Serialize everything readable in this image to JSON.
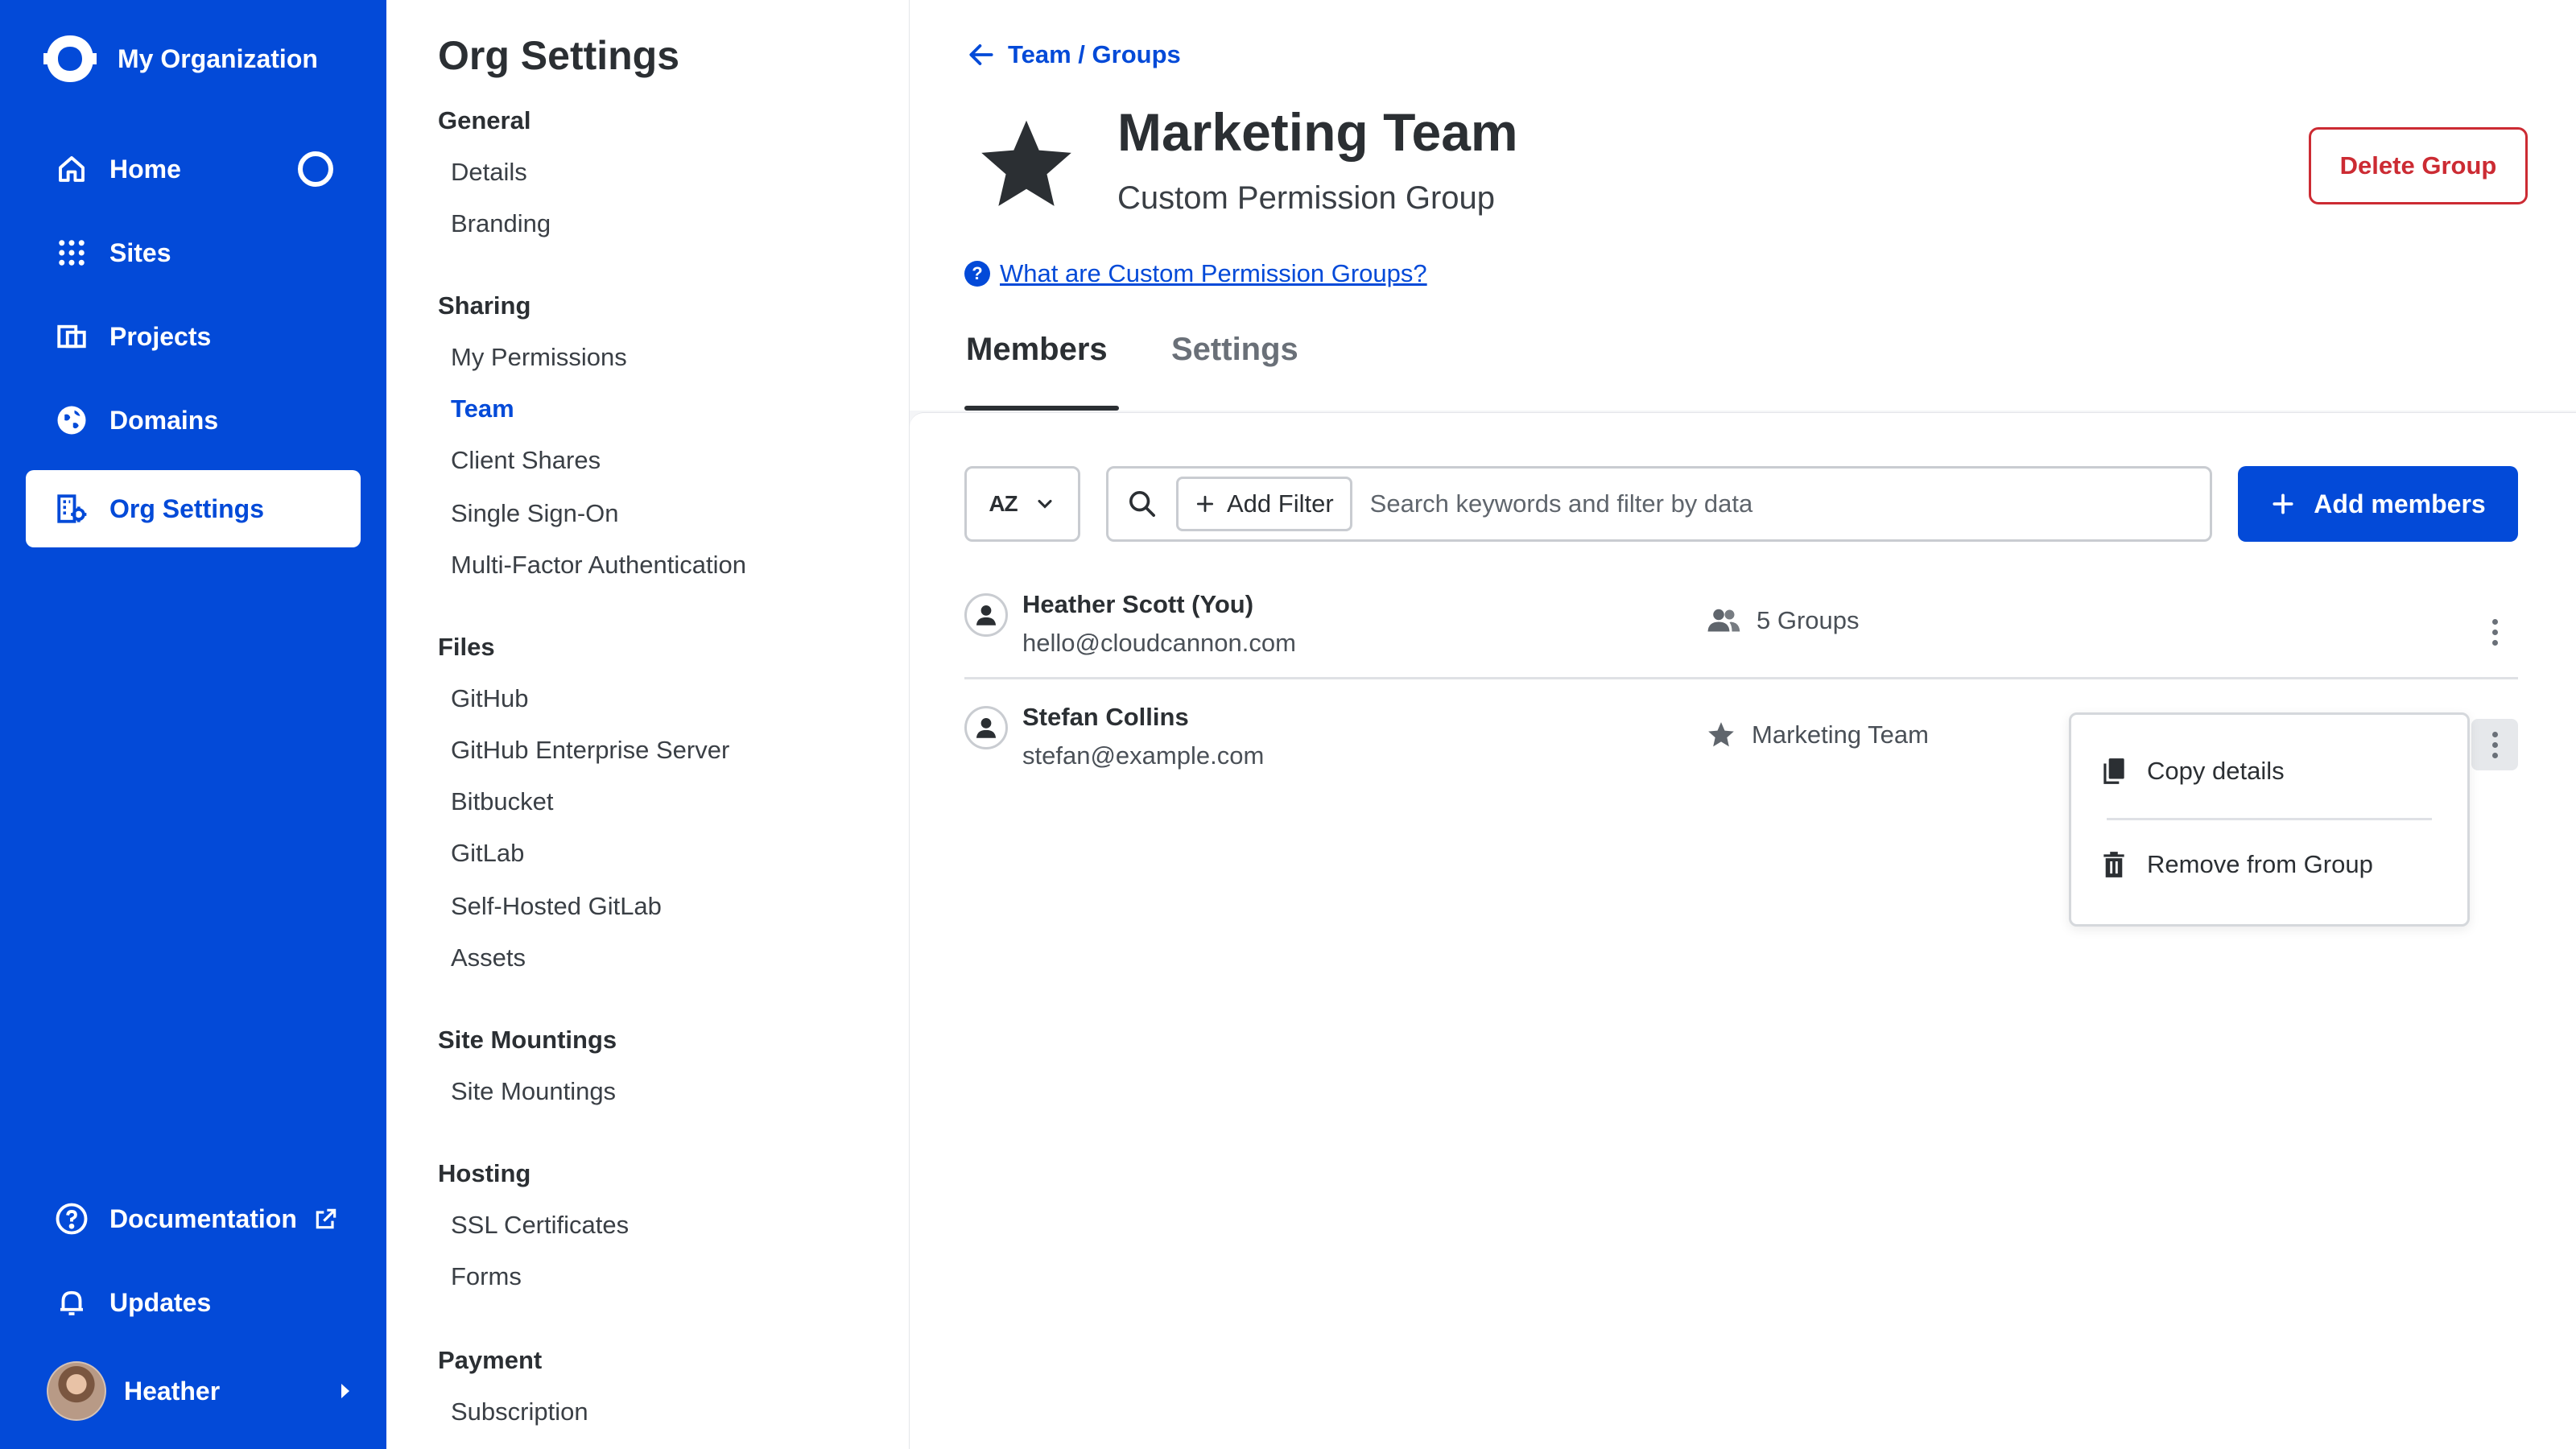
{
  "org": {
    "name": "My Organization"
  },
  "nav": {
    "items": [
      {
        "label": "Home",
        "icon": "home-icon"
      },
      {
        "label": "Sites",
        "icon": "grid-icon"
      },
      {
        "label": "Projects",
        "icon": "projects-icon"
      },
      {
        "label": "Domains",
        "icon": "globe-icon"
      },
      {
        "label": "Org Settings",
        "icon": "org-settings-icon",
        "active": true
      }
    ],
    "bottom": [
      {
        "label": "Documentation",
        "icon": "help-circle-icon"
      },
      {
        "label": "Updates",
        "icon": "bell-icon"
      }
    ],
    "user": {
      "name": "Heather"
    }
  },
  "settings": {
    "title": "Org Settings",
    "sections": [
      {
        "title": "General",
        "items": [
          "Details",
          "Branding"
        ]
      },
      {
        "title": "Sharing",
        "items": [
          "My Permissions",
          "Team",
          "Client Shares",
          "Single Sign-On",
          "Multi-Factor Authentication"
        ]
      },
      {
        "title": "Files",
        "items": [
          "GitHub",
          "GitHub Enterprise Server",
          "Bitbucket",
          "GitLab",
          "Self-Hosted GitLab",
          "Assets"
        ]
      },
      {
        "title": "Site Mountings",
        "items": [
          "Site Mountings"
        ]
      },
      {
        "title": "Hosting",
        "items": [
          "SSL Certificates",
          "Forms"
        ]
      },
      {
        "title": "Payment",
        "items": [
          "Subscription"
        ]
      }
    ],
    "active_item": "Team"
  },
  "header": {
    "breadcrumb": "Team / Groups",
    "group_title": "Marketing Team",
    "group_subtitle": "Custom Permission Group",
    "delete_label": "Delete Group",
    "help_link": "What are Custom Permission Groups?",
    "help_glyph": "?",
    "tabs": [
      {
        "label": "Members",
        "active": true
      },
      {
        "label": "Settings",
        "active": false
      }
    ]
  },
  "toolbar": {
    "sort_label": "AZ",
    "add_filter_label": "Add Filter",
    "search_placeholder": "Search keywords and filter by data",
    "add_members_label": "Add members"
  },
  "members": [
    {
      "name": "Heather Scott (You)",
      "email": "hello@cloudcannon.com",
      "groups_label": "5 Groups",
      "groups_icon": "people-icon"
    },
    {
      "name": "Stefan Collins",
      "email": "stefan@example.com",
      "groups_label": "Marketing Team",
      "groups_icon": "star-icon"
    }
  ],
  "context_menu": {
    "items": [
      {
        "label": "Copy details",
        "icon": "copy-icon"
      },
      {
        "label": "Remove from Group",
        "icon": "trash-icon"
      }
    ]
  },
  "colors": {
    "brand": "#034ad8",
    "danger": "#cc2b33",
    "text": "#2b2f33"
  }
}
